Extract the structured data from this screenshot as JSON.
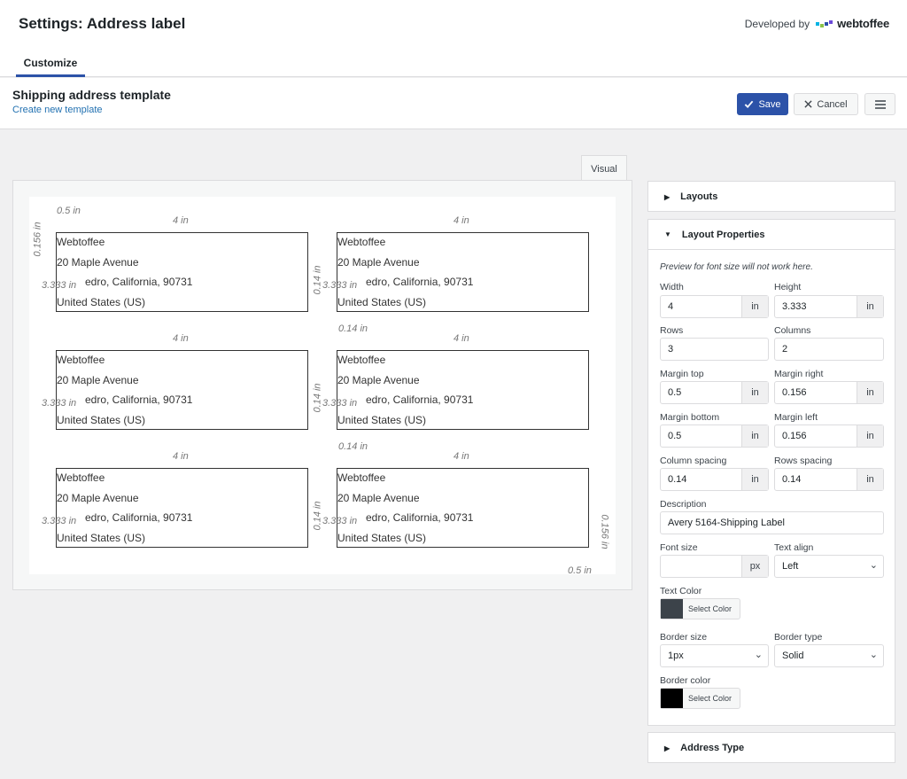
{
  "header": {
    "title": "Settings: Address label",
    "developed_by": "Developed by",
    "brand": "webtoffee",
    "tab": "Customize"
  },
  "template": {
    "name": "Shipping address template",
    "create_link": "Create new template",
    "save": "Save",
    "cancel": "Cancel"
  },
  "preview": {
    "tab": "Visual",
    "label_lines": [
      "Webtoffee",
      "20 Maple Avenue",
      "edro, California, 90731",
      "United States (US)"
    ],
    "dims": {
      "width": "4 in",
      "height": "3.333 in",
      "col_spacing": "0.14 in",
      "row_spacing": "0.14 in",
      "margin_top": "0.5 in",
      "margin_bottom": "0.5 in",
      "margin_left": "0.156 in",
      "margin_right": "0.156 in"
    },
    "rows": 3,
    "columns": 2
  },
  "panels": {
    "layouts": "Layouts",
    "layout_properties": "Layout Properties",
    "address_type": "Address Type",
    "note": "Preview for font size will not work here."
  },
  "props": {
    "width_label": "Width",
    "width_value": "4",
    "width_unit": "in",
    "height_label": "Height",
    "height_value": "3.333",
    "height_unit": "in",
    "rows_label": "Rows",
    "rows_value": "3",
    "columns_label": "Columns",
    "columns_value": "2",
    "margin_top_label": "Margin top",
    "margin_top_value": "0.5",
    "margin_top_unit": "in",
    "margin_right_label": "Margin right",
    "margin_right_value": "0.156",
    "margin_right_unit": "in",
    "margin_bottom_label": "Margin bottom",
    "margin_bottom_value": "0.5",
    "margin_bottom_unit": "in",
    "margin_left_label": "Margin left",
    "margin_left_value": "0.156",
    "margin_left_unit": "in",
    "col_spacing_label": "Column spacing",
    "col_spacing_value": "0.14",
    "col_spacing_unit": "in",
    "rows_spacing_label": "Rows spacing",
    "rows_spacing_value": "0.14",
    "rows_spacing_unit": "in",
    "description_label": "Description",
    "description_value": "Avery 5164-Shipping Label",
    "font_size_label": "Font size",
    "font_size_value": "",
    "font_size_unit": "px",
    "text_align_label": "Text align",
    "text_align_value": "Left",
    "text_color_label": "Text Color",
    "text_color": "#3c434a",
    "select_color": "Select Color",
    "border_size_label": "Border size",
    "border_size_value": "1px",
    "border_type_label": "Border type",
    "border_type_value": "Solid",
    "border_color_label": "Border color",
    "border_color": "#000000"
  },
  "colors": {
    "accent": "#2c52a8",
    "link": "#2271b1"
  }
}
